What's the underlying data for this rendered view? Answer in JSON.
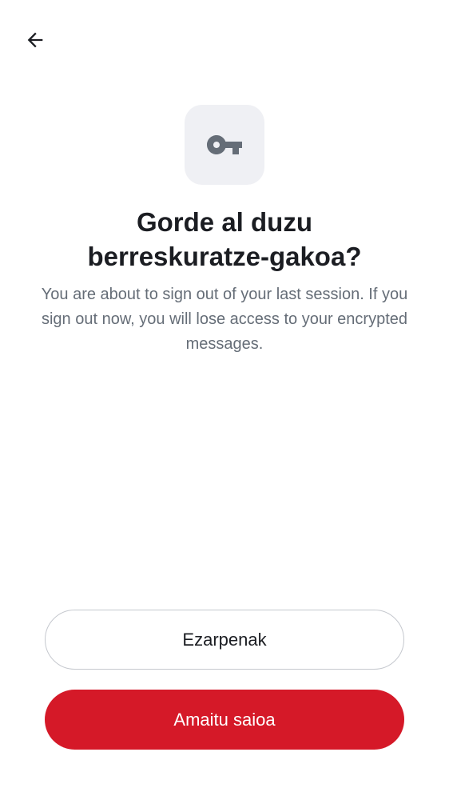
{
  "header": {
    "back_icon": "arrow-left-icon"
  },
  "hero": {
    "icon": "key-icon"
  },
  "content": {
    "title_line1": "Gorde al duzu",
    "title_line2": "berreskuratze-gakoa?",
    "subtitle": "You are about to sign out of your last session. If you sign out now, you will lose access to your encrypted messages."
  },
  "actions": {
    "settings_label": "Ezarpenak",
    "signout_label": "Amaitu saioa"
  },
  "colors": {
    "primary": "#d51928",
    "text": "#1b1d22",
    "muted": "#656d77",
    "tile": "#eff0f4"
  }
}
